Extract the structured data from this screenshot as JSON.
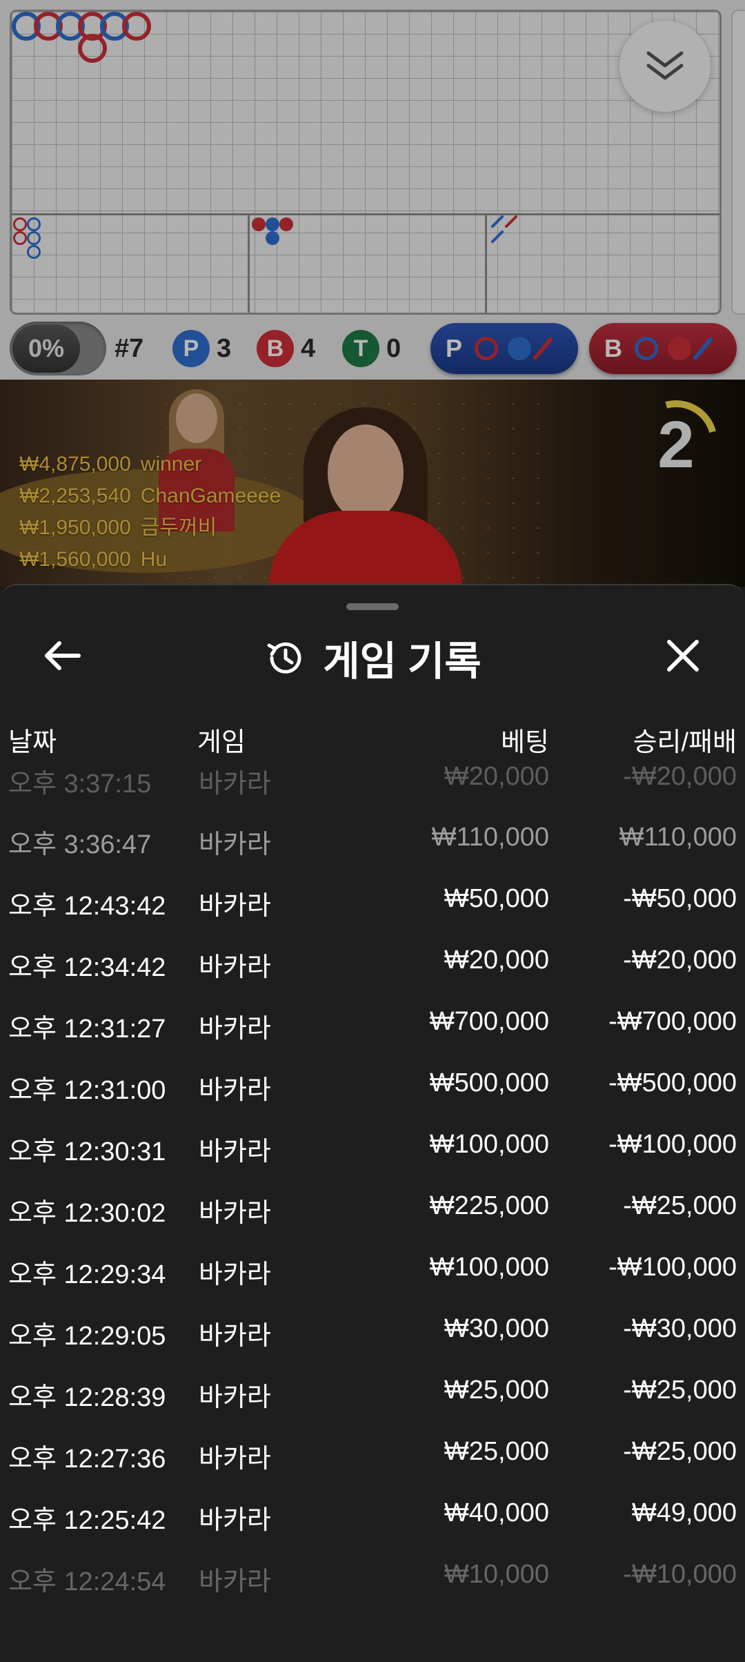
{
  "roadmap": {
    "edge_strip_label": "",
    "collapse_icon": "double-chevron-down-icon"
  },
  "stats": {
    "percent": "0%",
    "round": "#7",
    "player_letter": "P",
    "player_count": "3",
    "banker_letter": "B",
    "banker_count": "4",
    "tie_letter": "T",
    "tie_count": "0",
    "player_predict_label": "P",
    "banker_predict_label": "B",
    "colors": {
      "player": "#2f6fd0",
      "banker": "#d0303a",
      "tie": "#1f7a45"
    }
  },
  "video": {
    "leaderboard": [
      {
        "amount": "₩4,875,000",
        "name": "winner"
      },
      {
        "amount": "₩2,253,540",
        "name": "ChanGameeee"
      },
      {
        "amount": "₩1,950,000",
        "name": "금두꺼비"
      },
      {
        "amount": "₩1,560,000",
        "name": "Hu"
      }
    ],
    "timer": "2"
  },
  "history": {
    "title": "게임 기록",
    "columns": {
      "date": "날짜",
      "game": "게임",
      "bet": "베팅",
      "result": "승리/패배"
    },
    "rows": [
      {
        "date": "오후 3:37:15",
        "game": "바카라",
        "bet": "₩20,000",
        "result": "-₩20,000"
      },
      {
        "date": "오후 3:36:47",
        "game": "바카라",
        "bet": "₩110,000",
        "result": "₩110,000"
      },
      {
        "date": "오후 12:43:42",
        "game": "바카라",
        "bet": "₩50,000",
        "result": "-₩50,000"
      },
      {
        "date": "오후 12:34:42",
        "game": "바카라",
        "bet": "₩20,000",
        "result": "-₩20,000"
      },
      {
        "date": "오후 12:31:27",
        "game": "바카라",
        "bet": "₩700,000",
        "result": "-₩700,000"
      },
      {
        "date": "오후 12:31:00",
        "game": "바카라",
        "bet": "₩500,000",
        "result": "-₩500,000"
      },
      {
        "date": "오후 12:30:31",
        "game": "바카라",
        "bet": "₩100,000",
        "result": "-₩100,000"
      },
      {
        "date": "오후 12:30:02",
        "game": "바카라",
        "bet": "₩225,000",
        "result": "-₩25,000"
      },
      {
        "date": "오후 12:29:34",
        "game": "바카라",
        "bet": "₩100,000",
        "result": "-₩100,000"
      },
      {
        "date": "오후 12:29:05",
        "game": "바카라",
        "bet": "₩30,000",
        "result": "-₩30,000"
      },
      {
        "date": "오후 12:28:39",
        "game": "바카라",
        "bet": "₩25,000",
        "result": "-₩25,000"
      },
      {
        "date": "오후 12:27:36",
        "game": "바카라",
        "bet": "₩25,000",
        "result": "-₩25,000"
      },
      {
        "date": "오후 12:25:42",
        "game": "바카라",
        "bet": "₩40,000",
        "result": "₩49,000"
      },
      {
        "date": "오후 12:24:54",
        "game": "바카라",
        "bet": "₩10,000",
        "result": "-₩10,000"
      }
    ]
  }
}
